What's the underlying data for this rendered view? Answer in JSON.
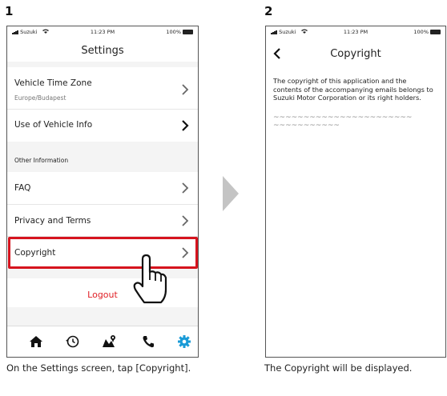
{
  "steps": {
    "one": "1",
    "two": "2"
  },
  "status_bar": {
    "carrier": "Suzuki",
    "time": "11:23 PM",
    "battery": "100%"
  },
  "settings_screen": {
    "title": "Settings",
    "items": [
      {
        "label": "Vehicle Time Zone",
        "value": "Europe/Budapest"
      },
      {
        "label": "Use of Vehicle Info"
      },
      {
        "label": "FAQ"
      },
      {
        "label": "Privacy and Terms"
      },
      {
        "label": "Copyright"
      }
    ],
    "section_header": "Other Information",
    "logout_label": "Logout",
    "tabs": [
      "home-icon",
      "history-icon",
      "map-icon",
      "phone-icon",
      "gear-icon"
    ],
    "accent_color": "#1a9bd7",
    "highlight_color": "#d6141e"
  },
  "copyright_screen": {
    "title": "Copyright",
    "back_glyph": "<",
    "body": "The copyright of this application and the contents of the accompanying emails belongs to Suzuki Motor Corporation or its right holders.",
    "tilde_line_1": "~~~~~~~~~~~~~~~~~~~~~~~",
    "tilde_line_2": "~~~~~~~~~~~"
  },
  "captions": {
    "step1": "On the Settings screen, tap [Copyright].",
    "step2": "The Copyright will be displayed."
  }
}
